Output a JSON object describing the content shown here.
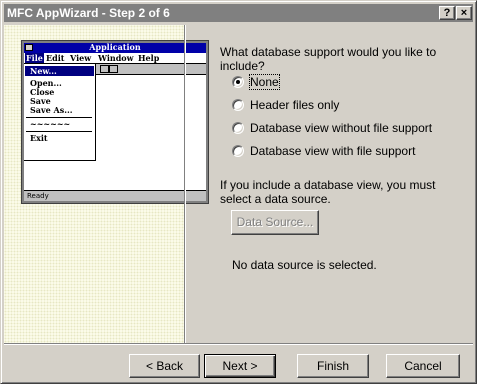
{
  "window": {
    "title": "MFC AppWizard - Step 2 of 6",
    "help_button": "?",
    "close_button": "×"
  },
  "preview": {
    "app_title": "Application",
    "menu": [
      "File",
      "Edit",
      "View",
      "Window",
      "Help"
    ],
    "file_menu_items": [
      "New...",
      "Open...",
      "Close",
      "Save",
      "Save As...",
      "~~~~~~",
      "Exit"
    ],
    "status_text": "Ready"
  },
  "question": "What database support would you like to include?",
  "options": [
    {
      "label": "None",
      "selected": true
    },
    {
      "label": "Header files only",
      "selected": false
    },
    {
      "label": "Database view without file support",
      "selected": false
    },
    {
      "label": "Database view with file support",
      "selected": false
    }
  ],
  "info_text": "If you include a database view, you must select a data source.",
  "data_source_button": "Data Source...",
  "no_data_source_text": "No data source is selected.",
  "buttons": {
    "back": "< Back",
    "next": "Next >",
    "finish": "Finish",
    "cancel": "Cancel"
  },
  "colors": {
    "title_bar": "#808080",
    "preview_title": "#0000a8",
    "dialog_bg": "#d4d0c8"
  }
}
